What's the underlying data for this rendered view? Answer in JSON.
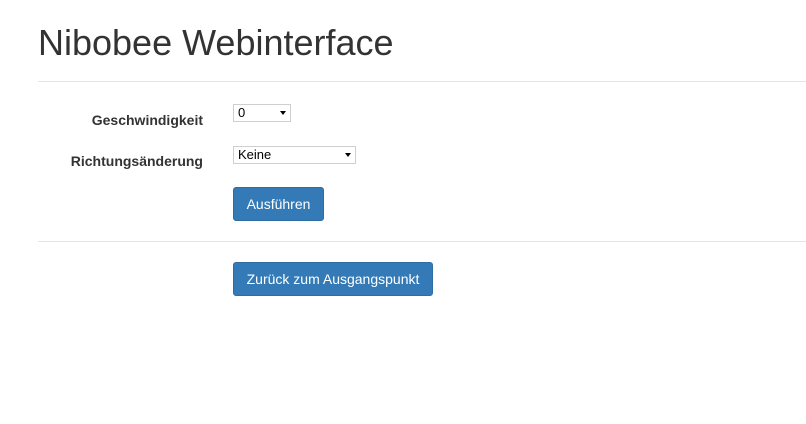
{
  "header": {
    "title": "Nibobee Webinterface"
  },
  "form": {
    "speed": {
      "label": "Geschwindigkeit",
      "selected": "0"
    },
    "direction": {
      "label": "Richtungsänderung",
      "selected": "Keine"
    },
    "run_button": "Ausführen"
  },
  "actions": {
    "back_button": "Zurück zum Ausgangspunkt"
  },
  "colors": {
    "primary": "#337ab7",
    "primary_border": "#2e6da4",
    "text": "#333333",
    "divider": "#e5e5e5"
  }
}
